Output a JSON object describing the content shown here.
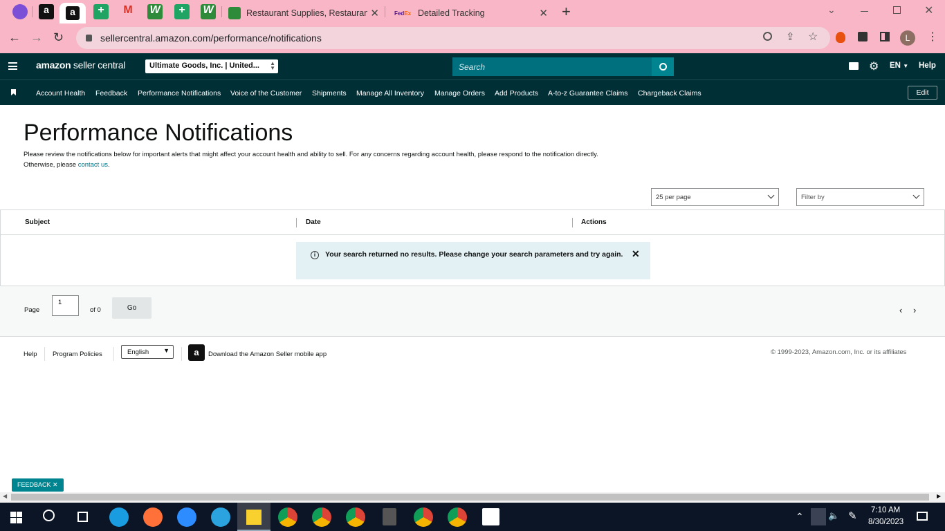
{
  "browser": {
    "tabs": [
      {
        "title": "Restaurant Supplies, Restaurant S"
      },
      {
        "title": "Detailed Tracking"
      }
    ],
    "url": "sellercentral.amazon.com/performance/notifications",
    "profile_letter": "L"
  },
  "header": {
    "logo_main": "amazon",
    "logo_sub": " seller central",
    "merchant": "Ultimate Goods, Inc. | United...",
    "search_placeholder": "Search",
    "lang": "EN",
    "help": "Help"
  },
  "nav": {
    "items": [
      "Account Health",
      "Feedback",
      "Performance Notifications",
      "Voice of the Customer",
      "Shipments",
      "Manage All Inventory",
      "Manage Orders",
      "Add Products",
      "A-to-z Guarantee Claims",
      "Chargeback Claims"
    ],
    "edit": "Edit"
  },
  "page": {
    "title": "Performance Notifications",
    "desc": "Please review the notifications below for important alerts that might affect your account health and ability to sell. For any concerns regarding account health, please respond to the notification directly. Otherwise, please ",
    "contact": "contact us",
    "desc_end": ".",
    "per_page": "25 per page",
    "filter": "Filter by"
  },
  "table": {
    "columns": [
      "Subject",
      "Date",
      "Actions"
    ],
    "empty_message": "Your search returned no results. Please change your search parameters and try again."
  },
  "pager": {
    "label": "Page",
    "value": "1",
    "of": "of 0",
    "go": "Go"
  },
  "footer": {
    "help": "Help",
    "policies": "Program Policies",
    "language": "English",
    "app": "Download the Amazon Seller mobile app",
    "copyright": "© 1999-2023, Amazon.com, Inc. or its affiliates"
  },
  "feedback": "FEEDBACK",
  "clock": {
    "time": "7:10 AM",
    "date": "8/30/2023"
  },
  "colors": {
    "header": "#002f36",
    "teal": "#00848f",
    "link": "#007185",
    "browser": "#f8b6c6"
  }
}
